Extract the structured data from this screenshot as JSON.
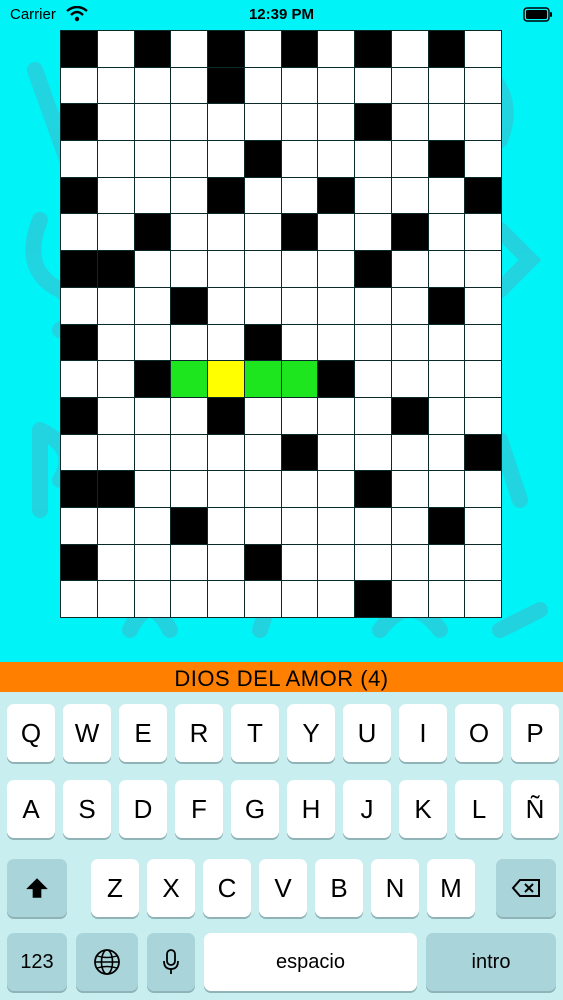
{
  "status": {
    "carrier": "Carrier",
    "time": "12:39 PM"
  },
  "grid": {
    "rows": [
      "101010101010",
      "000010000000",
      "100000001000",
      "000001000010",
      "100010010001",
      "001000100100",
      "110000001000",
      "000100000010",
      "100001000000",
      "001GYGG10000",
      "100010000100",
      "000000100001",
      "110000001000",
      "000100000010",
      "100001000000",
      "000000001000"
    ]
  },
  "clue": {
    "text": "DIOS DEL AMOR (4)"
  },
  "keyboard": {
    "row1": [
      "Q",
      "W",
      "E",
      "R",
      "T",
      "Y",
      "U",
      "I",
      "O",
      "P"
    ],
    "row2": [
      "A",
      "S",
      "D",
      "F",
      "G",
      "H",
      "J",
      "K",
      "L",
      "Ñ"
    ],
    "row3": [
      "Z",
      "X",
      "C",
      "V",
      "B",
      "N",
      "M"
    ],
    "numbers_label": "123",
    "space_label": "espacio",
    "return_label": "intro"
  }
}
